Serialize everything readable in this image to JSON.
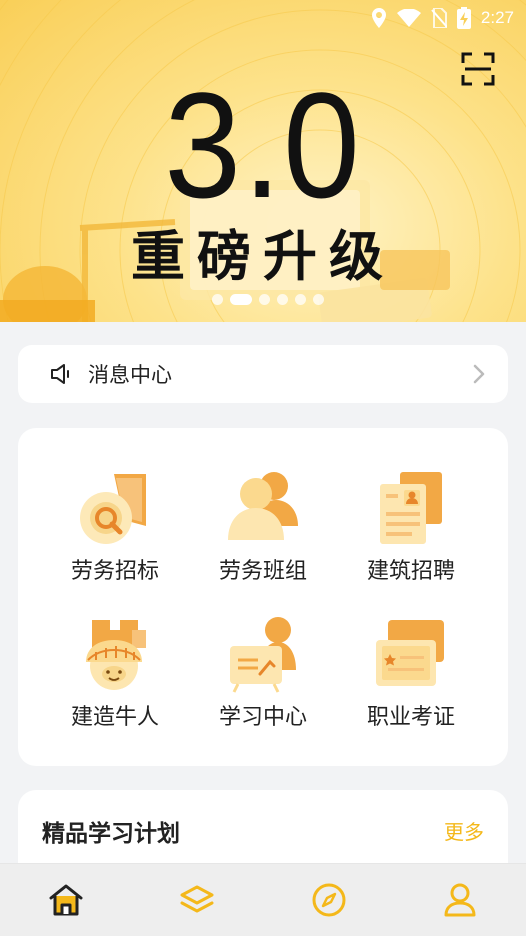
{
  "status_bar": {
    "time": "2:27"
  },
  "banner": {
    "big_text": "3.0",
    "sub_text": "重磅升级",
    "dots_count": 6,
    "active_dot": 1
  },
  "notice": {
    "label": "消息中心"
  },
  "features": [
    {
      "label": "劳务招标",
      "icon": "tender-search-icon"
    },
    {
      "label": "劳务班组",
      "icon": "team-people-icon"
    },
    {
      "label": "建筑招聘",
      "icon": "resume-card-icon"
    },
    {
      "label": "建造牛人",
      "icon": "builder-avatar-icon"
    },
    {
      "label": "学习中心",
      "icon": "teaching-board-icon"
    },
    {
      "label": "职业考证",
      "icon": "certificate-icon"
    }
  ],
  "plan": {
    "title": "精品学习计划",
    "more": "更多"
  },
  "bottom_nav": [
    {
      "name": "home",
      "icon": "home-icon",
      "active": true
    },
    {
      "name": "courses",
      "icon": "layers-icon",
      "active": false
    },
    {
      "name": "discover",
      "icon": "compass-icon",
      "active": false
    },
    {
      "name": "profile",
      "icon": "user-icon",
      "active": false
    }
  ],
  "colors": {
    "accent": "#f4b81a",
    "banner": "#fbd866",
    "text": "#222222"
  }
}
